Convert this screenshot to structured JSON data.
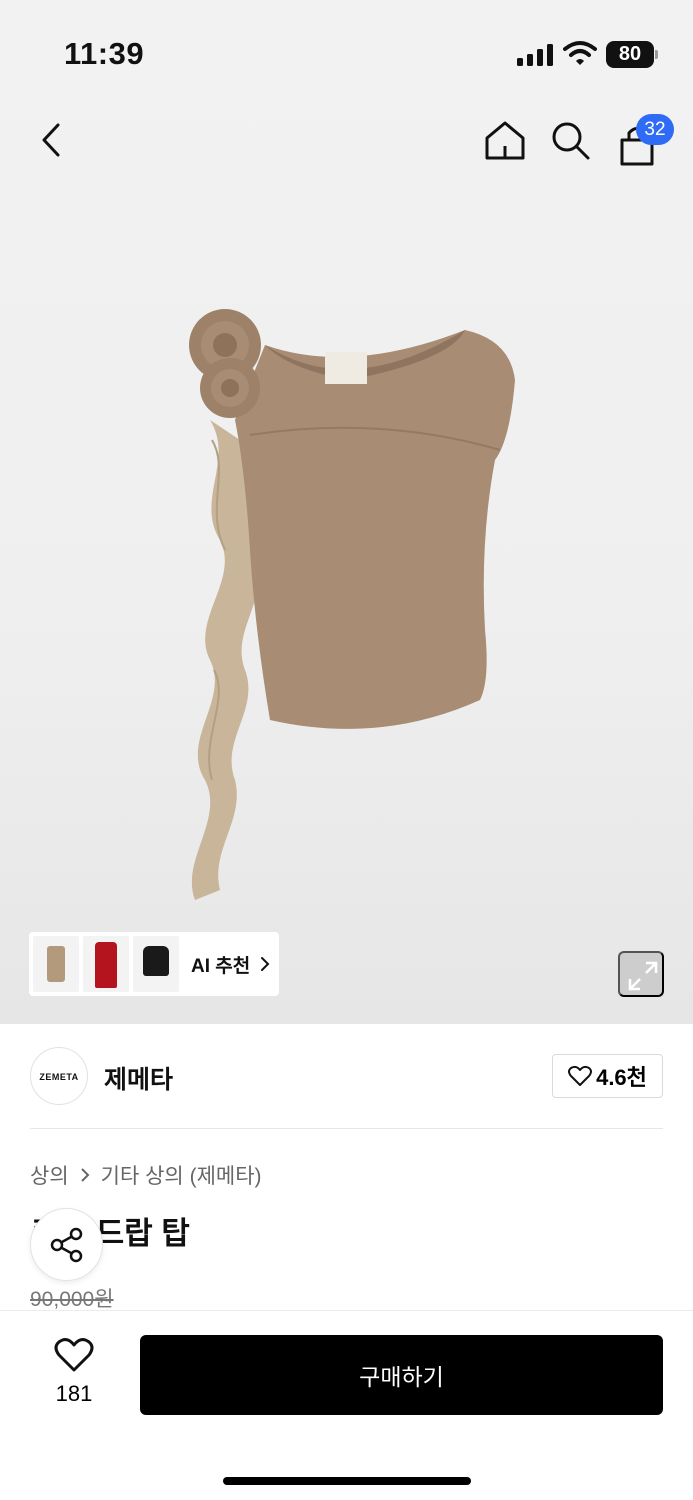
{
  "status_bar": {
    "time": "11:39",
    "battery": "80"
  },
  "nav": {
    "back_icon": "chevron-left-icon",
    "home_icon": "home-icon",
    "search_icon": "search-icon",
    "cart_icon": "shopping-bag-icon",
    "cart_badge": "32",
    "badge_color": "#2e6cf6"
  },
  "ai_recommend": {
    "label": "AI 추천",
    "thumb_colors": [
      "#b49a7c",
      "#b4141e",
      "#1a1a1a"
    ]
  },
  "brand": {
    "logo_text": "ZEMETA",
    "name": "제메타",
    "like_count": "4.6천"
  },
  "product": {
    "breadcrumb": [
      "상의",
      "기타 상의 (제메타)"
    ],
    "title": "로즈 드랍 탑",
    "price": "90,000원",
    "body_color": "#a88c73",
    "ruffle_color": "#c8b59a"
  },
  "bottom_bar": {
    "wish_count": "181",
    "buy_label": "구매하기"
  }
}
